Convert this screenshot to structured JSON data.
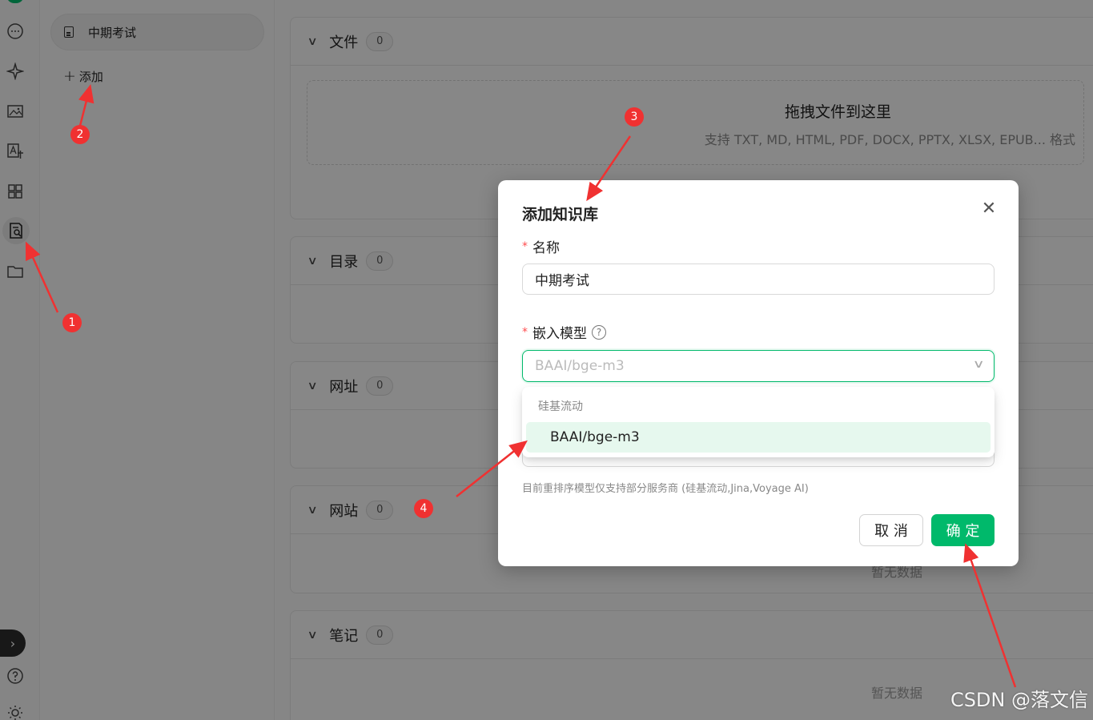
{
  "sidebar": {
    "icons": [
      "chat-icon",
      "sparkle-icon",
      "image-icon",
      "translate-icon",
      "apps-icon",
      "knowledge-icon",
      "folder-icon"
    ],
    "bottom_icons": [
      "help-icon",
      "theme-icon"
    ]
  },
  "kb_list": {
    "items": [
      {
        "label": "中期考试"
      }
    ],
    "add_label": "添加"
  },
  "panels": [
    {
      "title": "文件",
      "count": "0"
    },
    {
      "title": "目录",
      "count": "0"
    },
    {
      "title": "网址",
      "count": "0"
    },
    {
      "title": "网站",
      "count": "0"
    },
    {
      "title": "笔记",
      "count": "0"
    }
  ],
  "dropzone": {
    "title": "拖拽文件到这里",
    "subtitle": "支持 TXT, MD, HTML, PDF, DOCX, PPTX, XLSX, EPUB... 格式"
  },
  "empty_text": "暂无数据",
  "modal": {
    "title": "添加知识库",
    "name_label": "名称",
    "name_value": "中期考试",
    "model_label": "嵌入模型",
    "model_placeholder": "BAAI/bge-m3",
    "rerank_note": "目前重排序模型仅支持部分服务商 (硅基流动,Jina,Voyage AI)",
    "cancel_label": "取 消",
    "ok_label": "确 定"
  },
  "dropdown": {
    "group_label": "硅基流动",
    "options": [
      {
        "label": "BAAI/bge-m3",
        "selected": true
      }
    ]
  },
  "annotations": {
    "markers": [
      "1",
      "2",
      "3",
      "4"
    ],
    "color": "#f03131"
  },
  "watermark": "CSDN @落文信",
  "colors": {
    "accent": "#00b96b",
    "danger": "#ff4d4f"
  }
}
